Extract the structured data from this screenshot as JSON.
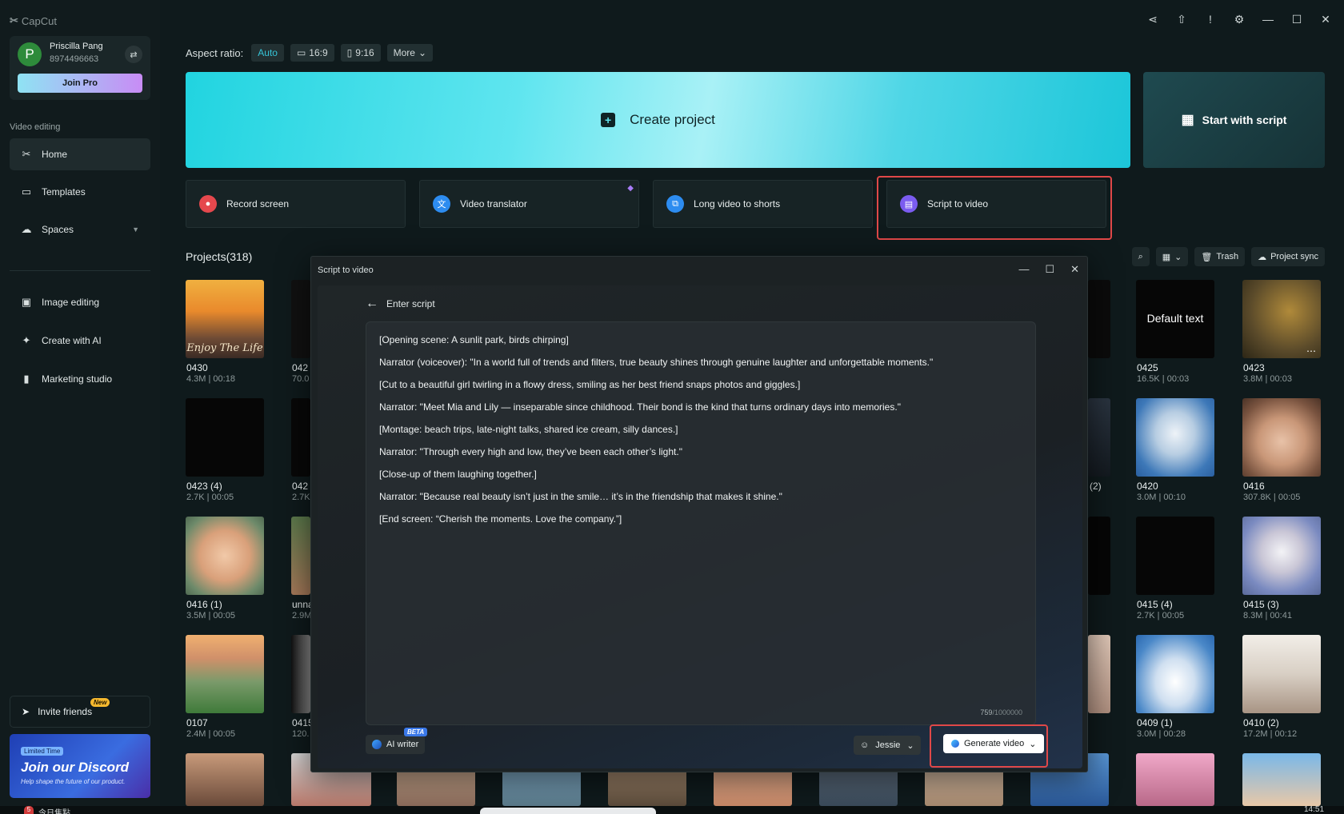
{
  "app": {
    "name": "CapCut"
  },
  "user": {
    "initial": "P",
    "name": "Priscilla Pang",
    "id": "8974496663",
    "join_pro": "Join Pro"
  },
  "sidebar": {
    "section_label": "Video editing",
    "items": [
      {
        "label": "Home",
        "icon": "scissors-icon"
      },
      {
        "label": "Templates",
        "icon": "template-icon"
      },
      {
        "label": "Spaces",
        "icon": "cloud-icon"
      },
      {
        "label": "Image editing",
        "icon": "image-icon"
      },
      {
        "label": "Create with AI",
        "icon": "sparkle-icon"
      },
      {
        "label": "Marketing studio",
        "icon": "briefcase-icon"
      }
    ],
    "invite": {
      "label": "Invite friends",
      "badge": "New"
    },
    "discord": {
      "tag": "Limited Time",
      "title": "Join our Discord",
      "subtitle": "Help shape the future of our product."
    }
  },
  "aspect": {
    "label": "Aspect ratio:",
    "options": [
      "Auto",
      "16:9",
      "9:16",
      "More"
    ]
  },
  "hero": {
    "create": "Create project",
    "start_script": "Start with script"
  },
  "tools": [
    {
      "label": "Record screen",
      "color": "#e5484d"
    },
    {
      "label": "Video translator",
      "color": "#2d8cf0"
    },
    {
      "label": "Long video to shorts",
      "color": "#2d8cf0"
    },
    {
      "label": "Script to video",
      "color": "#7b5cf0"
    }
  ],
  "projects": {
    "title": "Projects(318)",
    "trash": "Trash",
    "sync": "Project sync",
    "items": [
      {
        "name": "0430",
        "meta": "4.3M | 00:18",
        "thumb_text": "Enjoy The Life"
      },
      {
        "name": "042",
        "meta": "70.0"
      },
      {
        "name": "0425",
        "meta": "16.5K | 00:03",
        "thumb_text": "Default text"
      },
      {
        "name": "0423",
        "meta": "3.8M | 00:03"
      },
      {
        "name": "0423 (4)",
        "meta": "2.7K | 00:05"
      },
      {
        "name": "042",
        "meta": "2.7K"
      },
      {
        "name": "(2)",
        "meta": ""
      },
      {
        "name": "0420",
        "meta": "3.0M | 00:10"
      },
      {
        "name": "0416",
        "meta": "307.8K | 00:05"
      },
      {
        "name": "0416 (1)",
        "meta": "3.5M | 00:05"
      },
      {
        "name": "unna",
        "meta": "2.9M"
      },
      {
        "name": "0415 (4)",
        "meta": "2.7K | 00:05"
      },
      {
        "name": "0415 (3)",
        "meta": "8.3M | 00:41"
      },
      {
        "name": "0107",
        "meta": "2.4M | 00:05"
      },
      {
        "name": "0415",
        "meta": "120."
      },
      {
        "name": "0409 (1)",
        "meta": "3.0M | 00:28"
      },
      {
        "name": "0410 (2)",
        "meta": "17.2M | 00:12"
      }
    ]
  },
  "dialog": {
    "title": "Script to video",
    "back": "Enter script",
    "script": [
      "[Opening scene: A sunlit park, birds chirping]",
      "Narrator (voiceover): \"In a world full of trends and filters, true beauty shines through genuine laughter and unforgettable moments.\"",
      "[Cut to a beautiful girl twirling in a flowy dress, smiling as her best friend snaps photos and giggles.]",
      "Narrator: \"Meet Mia and Lily — inseparable since childhood. Their bond is the kind that turns ordinary days into memories.\"",
      "[Montage: beach trips, late-night talks, shared ice cream, silly dances.]",
      "Narrator: \"Through every high and low, they’ve been each other’s light.\"",
      "[Close-up of them laughing together.]",
      "Narrator: \"Because real beauty isn’t just in the smile… it’s in the friendship that makes it shine.\"",
      "[End screen: “Cherish the moments. Love the company.”]"
    ],
    "count": "759",
    "limit": "/1000000",
    "ai_writer": "AI writer",
    "beta": "BETA",
    "voice": "Jessie",
    "generate": "Generate video"
  },
  "taskbar": {
    "badge": "5",
    "text": "今日焦點",
    "clock": "14:51"
  },
  "colors": {
    "accent": "#36c3d6",
    "highlight": "#e04848"
  }
}
